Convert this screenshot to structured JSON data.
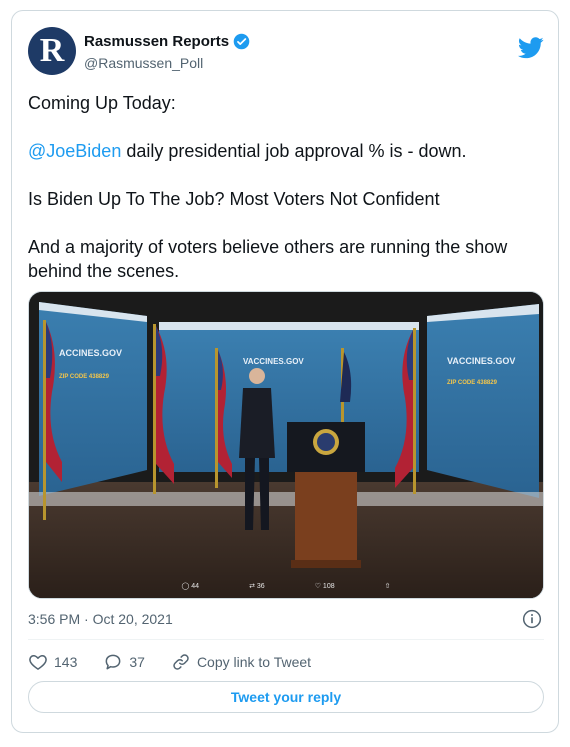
{
  "author": {
    "display_name": "Rasmussen Reports",
    "handle": "@Rasmussen_Poll",
    "avatar_letter": "R",
    "verified": true
  },
  "tweet": {
    "line1": "Coming Up Today:",
    "line2_mention": "@JoeBiden",
    "line2_rest": " daily presidential job approval % is - down.",
    "line3": "Is Biden Up To The Job? Most Voters Not Confident",
    "line4": "And a majority of voters believe others are running the show behind the scenes."
  },
  "media": {
    "description_icon": "video-thumbnail",
    "screen_text_left": "ACCINES.GOV",
    "screen_text_center": "VACCINES.GOV",
    "screen_text_right": "VACCINES.GOV",
    "screen_zip_left": "ZIP CODE 438829",
    "screen_zip_right": "ZIP CODE 438829",
    "overlay_replies": "44",
    "overlay_retweets": "36",
    "overlay_likes": "108"
  },
  "meta": {
    "timestamp": "3:56 PM · Oct 20, 2021"
  },
  "actions": {
    "likes": "143",
    "replies": "37",
    "copy_link_label": "Copy link to Tweet"
  },
  "reply_button": "Tweet your reply",
  "colors": {
    "accent": "#1d9bf0",
    "secondary_text": "#536471",
    "border": "#cfd9de"
  }
}
